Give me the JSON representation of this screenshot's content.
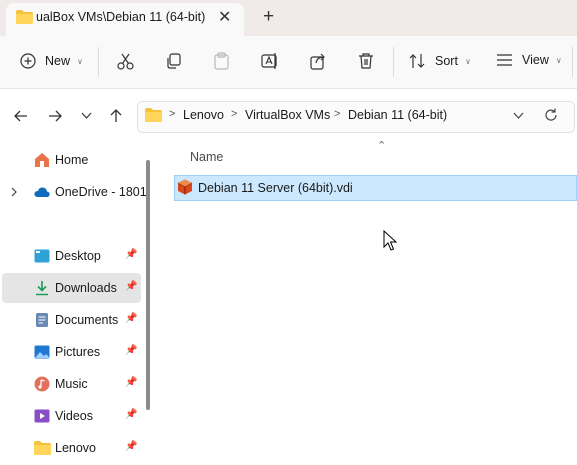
{
  "window": {
    "tab_title": "ualBox VMs\\Debian 11 (64-bit)",
    "close_glyph": "✕",
    "new_tab_glyph": "+"
  },
  "toolbar": {
    "new_label": "New",
    "sort_label": "Sort",
    "view_label": "View"
  },
  "address": {
    "crumbs": [
      "Lenovo",
      "VirtualBox VMs",
      "Debian 11 (64-bit)"
    ],
    "separator": ">"
  },
  "sidebar": {
    "items": [
      {
        "label": "Home",
        "icon": "home-icon"
      },
      {
        "label": "OneDrive - 1801",
        "icon": "cloud-icon"
      },
      {
        "label": "Desktop",
        "icon": "desktop-icon",
        "pinned": true
      },
      {
        "label": "Downloads",
        "icon": "download-icon",
        "pinned": true,
        "selected": true
      },
      {
        "label": "Documents",
        "icon": "document-icon",
        "pinned": true
      },
      {
        "label": "Pictures",
        "icon": "picture-icon",
        "pinned": true
      },
      {
        "label": "Music",
        "icon": "music-icon",
        "pinned": true
      },
      {
        "label": "Videos",
        "icon": "video-icon",
        "pinned": true
      },
      {
        "label": "Lenovo",
        "icon": "folder-icon",
        "pinned": true
      }
    ]
  },
  "list": {
    "column_name": "Name",
    "files": [
      {
        "name": "Debian 11 Server (64bit).vdi",
        "icon": "virtualbox-disk-icon",
        "selected": true
      }
    ]
  },
  "colors": {
    "accent": "#0067c0",
    "selection": "#cce8ff",
    "folder": "#f5c33b"
  }
}
